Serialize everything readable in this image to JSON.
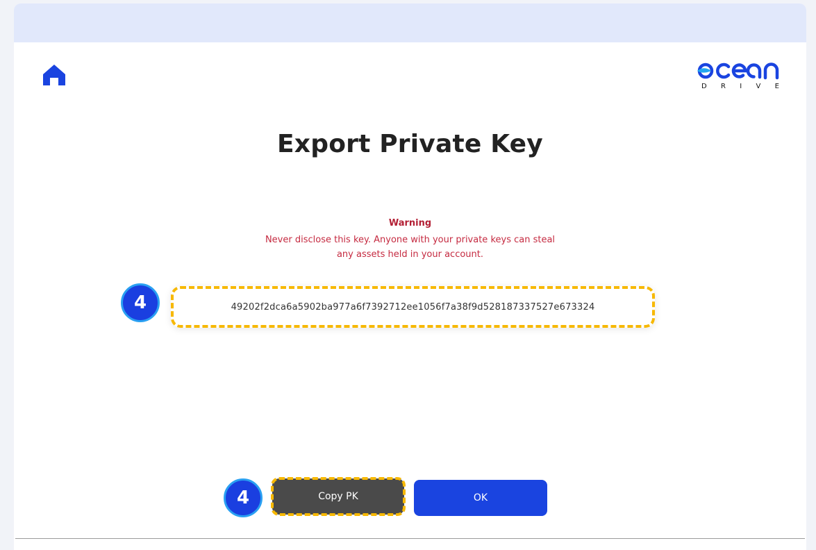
{
  "page": {
    "title": "Export Private Key",
    "warning_title": "Warning",
    "warning_text": "Never disclose this key. Anyone with your private keys can steal any assets held in your account.",
    "private_key": "49202f2dca6a5902ba977a6f7392712ee1056f7a38f9d528187337527e673324"
  },
  "logo": {
    "word": "ocean",
    "sub_letters": [
      "D",
      "R",
      "I",
      "V",
      "E"
    ]
  },
  "buttons": {
    "copy_label": "Copy PK",
    "ok_label": "OK"
  },
  "annotations": {
    "step_1": "4",
    "step_2": "4"
  },
  "icons": {
    "home": "home-icon"
  },
  "colors": {
    "accent": "#1a44e0",
    "warning": "#c52a40",
    "highlight": "#f7b800",
    "copy_button": "#4a4a4a"
  }
}
